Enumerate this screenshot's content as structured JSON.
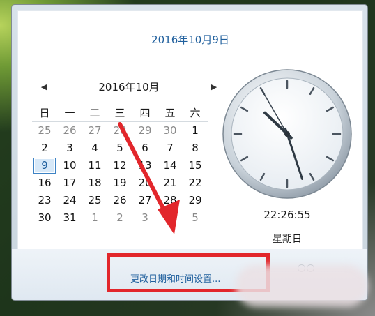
{
  "header": {
    "full_date": "2016年10月9日"
  },
  "calendar": {
    "prev_icon": "chevron-left-icon",
    "next_icon": "chevron-right-icon",
    "month_label": "2016年10月",
    "weekdays": [
      "日",
      "一",
      "二",
      "三",
      "四",
      "五",
      "六"
    ],
    "weeks": [
      [
        {
          "d": "25",
          "other": true
        },
        {
          "d": "26",
          "other": true
        },
        {
          "d": "27",
          "other": true
        },
        {
          "d": "28",
          "other": true
        },
        {
          "d": "29",
          "other": true
        },
        {
          "d": "30",
          "other": true
        },
        {
          "d": "1",
          "other": false
        }
      ],
      [
        {
          "d": "2",
          "other": false
        },
        {
          "d": "3",
          "other": false
        },
        {
          "d": "4",
          "other": false
        },
        {
          "d": "5",
          "other": false
        },
        {
          "d": "6",
          "other": false
        },
        {
          "d": "7",
          "other": false
        },
        {
          "d": "8",
          "other": false
        }
      ],
      [
        {
          "d": "9",
          "other": false,
          "selected": true
        },
        {
          "d": "10",
          "other": false
        },
        {
          "d": "11",
          "other": false
        },
        {
          "d": "12",
          "other": false
        },
        {
          "d": "13",
          "other": false
        },
        {
          "d": "14",
          "other": false
        },
        {
          "d": "15",
          "other": false
        }
      ],
      [
        {
          "d": "16",
          "other": false
        },
        {
          "d": "17",
          "other": false
        },
        {
          "d": "18",
          "other": false
        },
        {
          "d": "19",
          "other": false
        },
        {
          "d": "20",
          "other": false
        },
        {
          "d": "21",
          "other": false
        },
        {
          "d": "22",
          "other": false
        }
      ],
      [
        {
          "d": "23",
          "other": false
        },
        {
          "d": "24",
          "other": false
        },
        {
          "d": "25",
          "other": false
        },
        {
          "d": "26",
          "other": false
        },
        {
          "d": "27",
          "other": false
        },
        {
          "d": "28",
          "other": false
        },
        {
          "d": "29",
          "other": false
        }
      ],
      [
        {
          "d": "30",
          "other": false
        },
        {
          "d": "31",
          "other": false
        },
        {
          "d": "1",
          "other": true
        },
        {
          "d": "2",
          "other": true
        },
        {
          "d": "3",
          "other": true
        },
        {
          "d": "4",
          "other": true
        },
        {
          "d": "5",
          "other": true
        }
      ]
    ]
  },
  "clock": {
    "time": "22:26:55",
    "weekday": "星期日",
    "hours": 22,
    "minutes": 26,
    "seconds": 55
  },
  "footer": {
    "settings_link": "更改日期和时间设置..."
  },
  "annotation": {
    "highlight_color": "#e2262b"
  }
}
